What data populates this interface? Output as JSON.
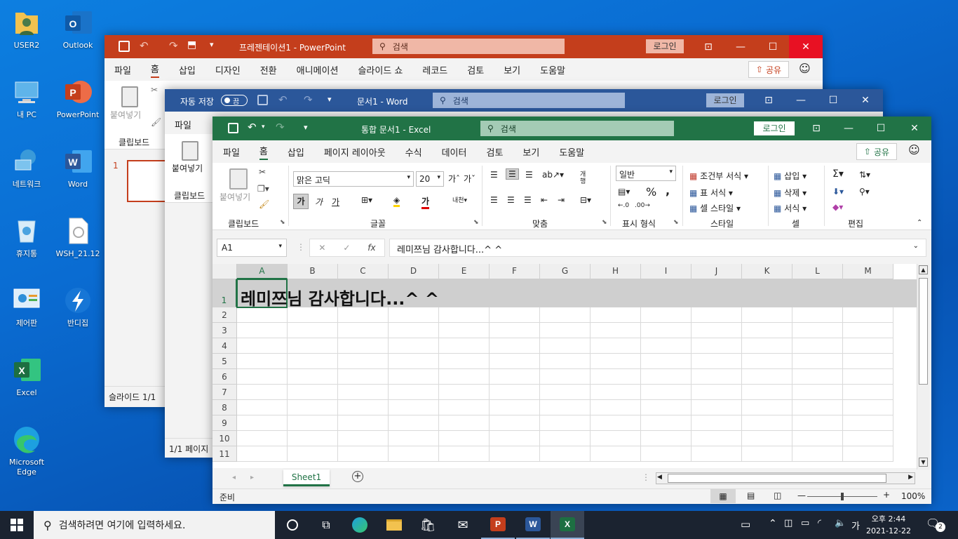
{
  "desktop": {
    "icons": [
      {
        "label": "USER2",
        "icon": "user-folder-icon"
      },
      {
        "label": "Outlook",
        "icon": "outlook-icon"
      },
      {
        "label": "내 PC",
        "icon": "pc-icon"
      },
      {
        "label": "PowerPoint",
        "icon": "powerpoint-icon"
      },
      {
        "label": "네트워크",
        "icon": "network-icon"
      },
      {
        "label": "Word",
        "icon": "word-icon"
      },
      {
        "label": "휴지통",
        "icon": "recycle-bin-icon"
      },
      {
        "label": "WSH_21.12",
        "icon": "file-icon"
      },
      {
        "label": "제어판",
        "icon": "control-panel-icon"
      },
      {
        "label": "반디집",
        "icon": "bandizip-icon"
      },
      {
        "label": "Excel",
        "icon": "excel-icon"
      },
      {
        "label": "Microsoft Edge",
        "icon": "edge-icon"
      }
    ]
  },
  "ppt": {
    "title": "프레젠테이션1 - PowerPoint",
    "search": "검색",
    "login": "로그인",
    "share": "공유",
    "tabs": [
      "파일",
      "홈",
      "삽입",
      "디자인",
      "전환",
      "애니메이션",
      "슬라이드 쇼",
      "레코드",
      "검토",
      "보기",
      "도움말"
    ],
    "paste": "붙여넣기",
    "clipboard": "클립보드",
    "slide_num": "1",
    "status": "슬라이드 1/1",
    "accent": "#c43e1c"
  },
  "word": {
    "autosave": "자동 저장",
    "toggle": "끔",
    "title": "문서1 - Word",
    "search": "검색",
    "login": "로그인",
    "tab_file": "파일",
    "paste": "붙여넣기",
    "clipboard": "클립보드",
    "status": "1/1 페이지",
    "accent": "#2b579a"
  },
  "excel": {
    "title": "통합 문서1 - Excel",
    "search": "검색",
    "login": "로그인",
    "share": "공유",
    "tabs": [
      "파일",
      "홈",
      "삽입",
      "페이지 레이아웃",
      "수식",
      "데이터",
      "검토",
      "보기",
      "도움말"
    ],
    "ribbon": {
      "paste": "붙여넣기",
      "clipboard": "클립보드",
      "font_name": "맑은 고딕",
      "font_size": "20",
      "font_group": "글꼴",
      "bold": "가",
      "italic": "가",
      "underline": "가",
      "align_group": "맞춤",
      "number_format": "일반",
      "number_group": "표시 형식",
      "cond_format": "조건부 서식",
      "table_format": "표 서식",
      "cell_style": "셀 스타일",
      "style_group": "스타일",
      "insert": "삽입",
      "delete": "삭제",
      "format": "서식",
      "cells_group": "셀",
      "edit_group": "편집",
      "wrap": "개행"
    },
    "name_box": "A1",
    "formula": "레미쯔님 감사합니다...^ ^",
    "columns": [
      "A",
      "B",
      "C",
      "D",
      "E",
      "F",
      "G",
      "H",
      "I",
      "J",
      "K",
      "L",
      "M"
    ],
    "rows": [
      "1",
      "2",
      "3",
      "4",
      "5",
      "6",
      "7",
      "8",
      "9",
      "10",
      "11"
    ],
    "cell_a1": "레미쯔님 감사합니다...^ ^",
    "sheet_tab": "Sheet1",
    "status": "준비",
    "zoom": "100%",
    "accent": "#217346"
  },
  "taskbar": {
    "search_placeholder": "검색하려면 여기에 입력하세요.",
    "time": "오후 2:44",
    "date": "2021-12-22",
    "ime": "가",
    "notif_count": "2"
  }
}
